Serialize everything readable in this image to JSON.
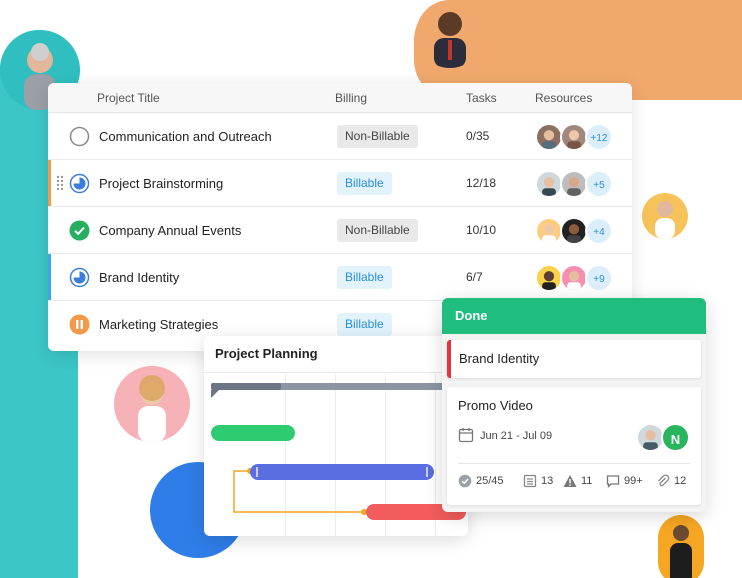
{
  "table": {
    "columns": {
      "project_title": "Project Title",
      "billing": "Billing",
      "tasks": "Tasks",
      "resources": "Resources"
    },
    "rows": [
      {
        "title": "Communication and Outreach",
        "status": "not-started",
        "billing": "Non-Billable",
        "tasks": "0/35",
        "more": "+12"
      },
      {
        "title": "Project Brainstorming",
        "status": "in-progress",
        "billing": "Billable",
        "tasks": "12/18",
        "more": "+5"
      },
      {
        "title": "Company Annual Events",
        "status": "completed",
        "billing": "Non-Billable",
        "tasks": "10/10",
        "more": "+4"
      },
      {
        "title": "Brand Identity",
        "status": "in-progress",
        "billing": "Billable",
        "tasks": "6/7",
        "more": "+9"
      },
      {
        "title": "Marketing Strategies",
        "status": "paused",
        "billing": "Billable",
        "tasks": "",
        "more": ""
      }
    ]
  },
  "gantt": {
    "title": "Project Planning"
  },
  "board": {
    "column_title": "Done",
    "cards": [
      {
        "title": "Brand Identity"
      },
      {
        "title": "Promo Video",
        "date_range": "Jun 21 - Jul 09",
        "assignee_initial": "N",
        "metrics": {
          "subtasks": "25/45",
          "lists": "13",
          "issues": "11",
          "comments": "99+",
          "attachments": "12"
        }
      }
    ]
  },
  "colors": {
    "accent_green": "#1fbe7e",
    "billable_blue": "#2a8fd8",
    "in_progress_orange": "#f2994a",
    "brand_identity_bar": "#3aa6e8",
    "urgent_red": "#e5333f",
    "gantt_green": "#2ecc71",
    "gantt_indigo": "#5b6ee1",
    "gantt_red": "#f25c5c"
  }
}
